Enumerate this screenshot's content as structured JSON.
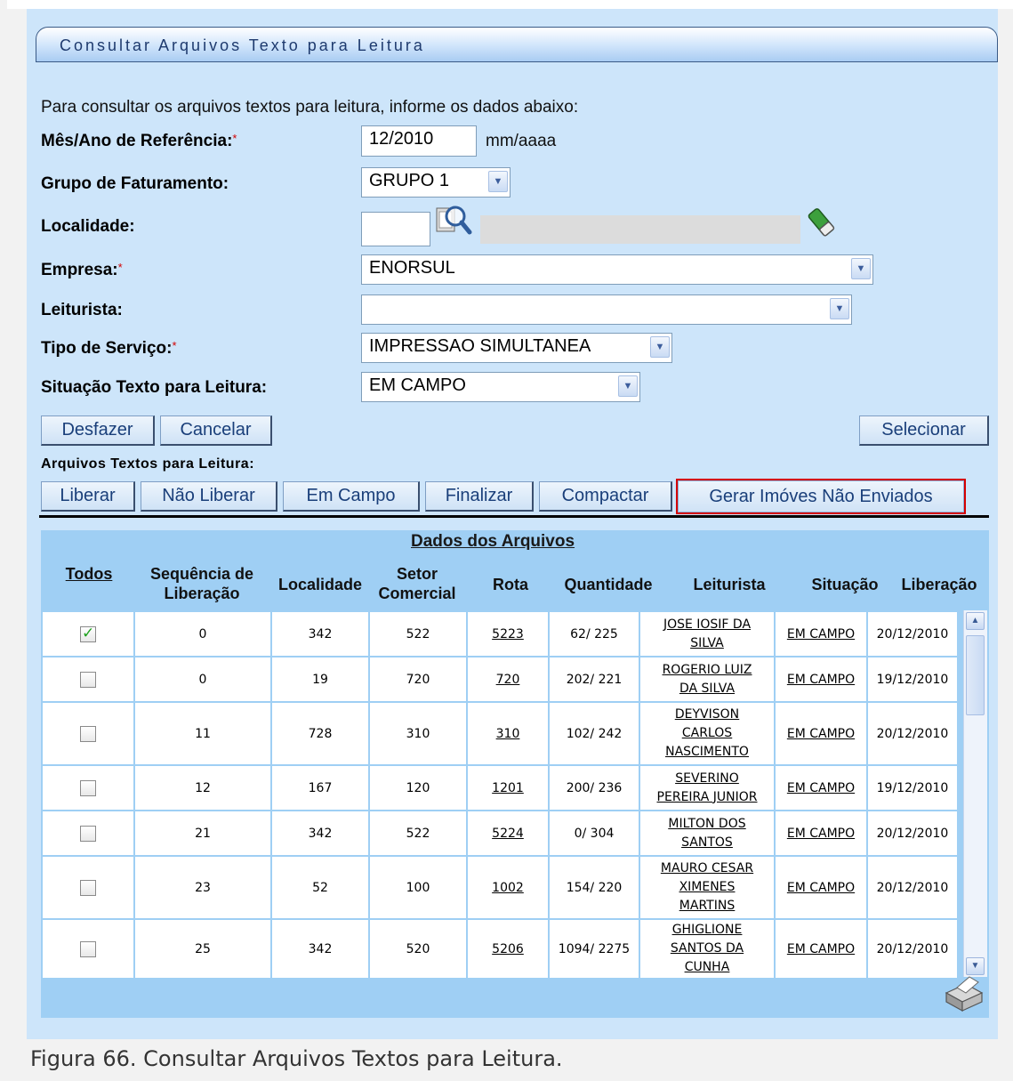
{
  "title": "Consultar Arquivos Texto para Leitura",
  "intro": "Para consultar os arquivos textos para leitura, informe os dados abaixo:",
  "form": {
    "mes_ano_label": "Mês/Ano de Referência:",
    "mes_ano_value": "12/2010",
    "mes_ano_hint": "mm/aaaa",
    "grupo_label": "Grupo de Faturamento:",
    "grupo_value": "GRUPO 1",
    "localidade_label": "Localidade:",
    "localidade_value": "",
    "localidade_desc": "",
    "empresa_label": "Empresa:",
    "empresa_value": "ENORSUL",
    "leiturista_label": "Leiturista:",
    "leiturista_value": "",
    "tipo_label": "Tipo de Serviço:",
    "tipo_value": "IMPRESSAO SIMULTANEA",
    "situacao_label": "Situação Texto para Leitura:",
    "situacao_value": "EM CAMPO",
    "required_mark": "*"
  },
  "buttons": {
    "desfazer": "Desfazer",
    "cancelar": "Cancelar",
    "selecionar": "Selecionar",
    "liberar": "Liberar",
    "nao_liberar": "Não Liberar",
    "em_campo": "Em Campo",
    "finalizar": "Finalizar",
    "compactar": "Compactar",
    "gerar": "Gerar Imóves Não Enviados"
  },
  "section_label": "Arquivos Textos para Leitura:",
  "table": {
    "caption": "Dados dos Arquivos",
    "headers": {
      "todos": "Todos",
      "sequencia_1": "Sequência de",
      "sequencia_2": "Liberação",
      "localidade": "Localidade",
      "setor_1": "Setor",
      "setor_2": "Comercial",
      "rota": "Rota",
      "quantidade": "Quantidade",
      "leiturista": "Leiturista",
      "situacao": "Situação",
      "liberacao": "Liberação"
    },
    "rows": [
      {
        "checked": true,
        "seq": "0",
        "loc": "342",
        "setor": "522",
        "rota": "5223",
        "qtd": "62/ 225",
        "leit": [
          "JOSE IOSIF DA",
          "SILVA"
        ],
        "sit": "EM CAMPO",
        "data": "20/12/2010"
      },
      {
        "checked": false,
        "seq": "0",
        "loc": "19",
        "setor": "720",
        "rota": "720",
        "qtd": "202/ 221",
        "leit": [
          "ROGERIO LUIZ",
          "DA SILVA"
        ],
        "sit": "EM CAMPO",
        "data": "19/12/2010"
      },
      {
        "checked": false,
        "seq": "11",
        "loc": "728",
        "setor": "310",
        "rota": "310",
        "qtd": "102/ 242",
        "leit": [
          "DEYVISON",
          "CARLOS",
          "NASCIMENTO"
        ],
        "sit": "EM CAMPO",
        "data": "20/12/2010"
      },
      {
        "checked": false,
        "seq": "12",
        "loc": "167",
        "setor": "120",
        "rota": "1201",
        "qtd": "200/ 236",
        "leit": [
          "SEVERINO",
          "PEREIRA JUNIOR"
        ],
        "sit": "EM CAMPO",
        "data": "19/12/2010"
      },
      {
        "checked": false,
        "seq": "21",
        "loc": "342",
        "setor": "522",
        "rota": "5224",
        "qtd": "0/ 304",
        "leit": [
          "MILTON DOS",
          "SANTOS"
        ],
        "sit": "EM CAMPO",
        "data": "20/12/2010"
      },
      {
        "checked": false,
        "seq": "23",
        "loc": "52",
        "setor": "100",
        "rota": "1002",
        "qtd": "154/ 220",
        "leit": [
          "MAURO CESAR",
          "XIMENES",
          "MARTINS"
        ],
        "sit": "EM CAMPO",
        "data": "20/12/2010"
      },
      {
        "checked": false,
        "seq": "25",
        "loc": "342",
        "setor": "520",
        "rota": "5206",
        "qtd": "1094/ 2275",
        "leit": [
          "GHIGLIONE",
          "SANTOS DA",
          "CUNHA"
        ],
        "sit": "EM CAMPO",
        "data": "20/12/2010"
      }
    ]
  },
  "figure_caption": "Figura 66. Consultar Arquivos Textos para Leitura.",
  "icons": {
    "search": "magnifier-icon",
    "clear": "eraser-icon",
    "print": "printer-icon"
  },
  "colors": {
    "panel": "#cde5fa",
    "table_bg": "#9fcff4",
    "highlight": "#d40000",
    "button_text": "#1a3f7a"
  }
}
